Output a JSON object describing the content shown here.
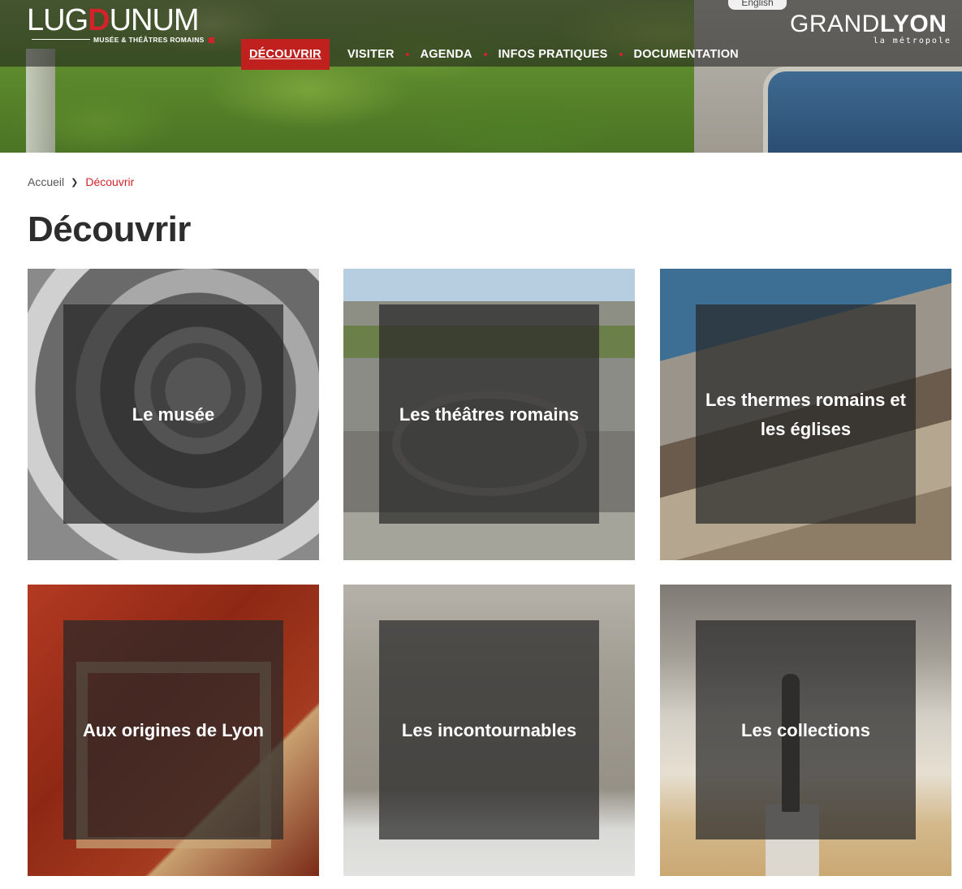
{
  "header": {
    "logo": {
      "word_start": "LUG",
      "word_highlight": "D",
      "word_end": "UNUM",
      "subtitle": "MUSÉE & THÉÂTRES ROMAINS"
    },
    "language_link": "English",
    "partner_logo": {
      "title_light": "GRAND",
      "title_bold": "LYON",
      "subtitle": "la métropole"
    },
    "nav": [
      {
        "label": "DÉCOUVRIR",
        "active": true
      },
      {
        "label": "VISITER",
        "active": false
      },
      {
        "label": "AGENDA",
        "active": false
      },
      {
        "label": "INFOS PRATIQUES",
        "active": false
      },
      {
        "label": "DOCUMENTATION",
        "active": false
      }
    ]
  },
  "breadcrumb": {
    "home": "Accueil",
    "separator": "❯",
    "current": "Découvrir"
  },
  "page_title": "Découvrir",
  "cards": [
    {
      "label": "Le musée"
    },
    {
      "label": "Les théâtres romains"
    },
    {
      "label": "Les thermes romains et les églises"
    },
    {
      "label": "Aux origines de Lyon"
    },
    {
      "label": "Les incontournables"
    },
    {
      "label": "Les collections"
    }
  ],
  "colors": {
    "accent_red": "#d2232a",
    "nav_active_bg": "#c0211f",
    "title_text": "#2d2d2d",
    "card_overlay": "rgba(40,40,40,0.72)"
  }
}
